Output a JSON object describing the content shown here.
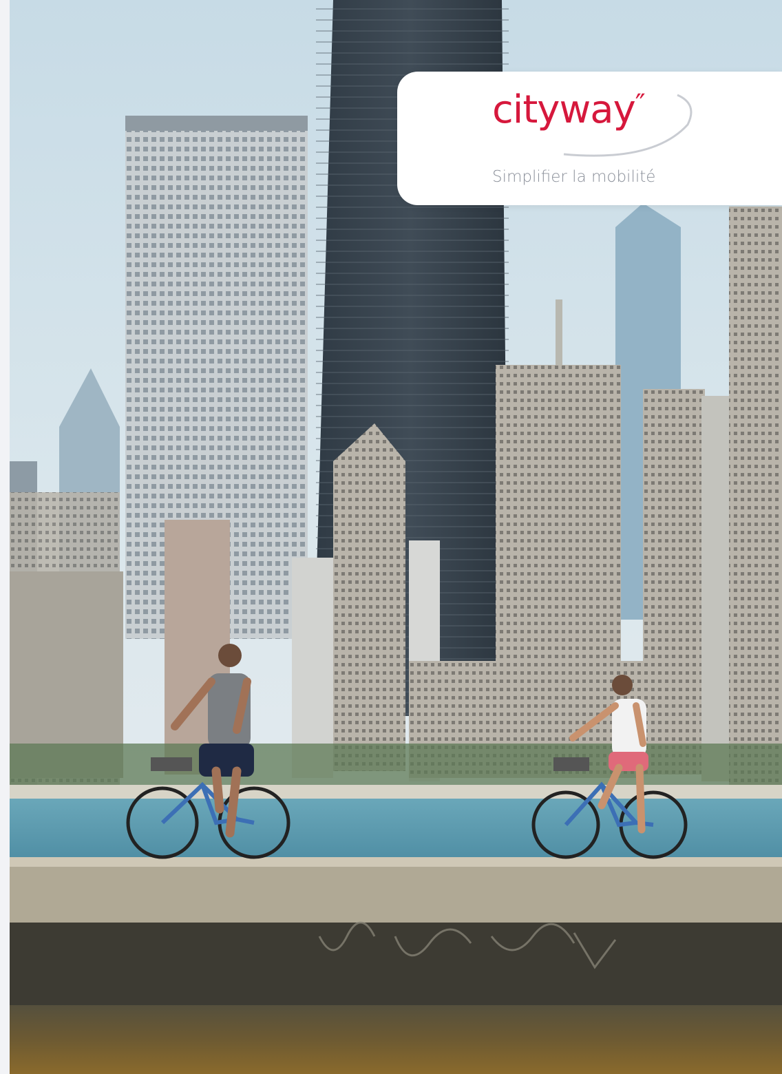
{
  "brand": {
    "name": "cityway",
    "mark": "″",
    "tagline": "Simplifier la mobilité",
    "colors": {
      "wordmark": "#d6183c",
      "tagline": "#8a8f99",
      "card": "#ffffff",
      "swoosh": "#c9ccd2"
    }
  },
  "scene": {
    "icons": [
      "skyline-icon",
      "cyclist-icon",
      "cyclist-icon",
      "bicycle-icon",
      "bicycle-icon"
    ],
    "colors": {
      "sky": "#cfdfe8",
      "tower": "#3a4650",
      "water": "#5f9fb0",
      "pier": "#b4ad9b",
      "bike": "#3c6fb5"
    }
  }
}
